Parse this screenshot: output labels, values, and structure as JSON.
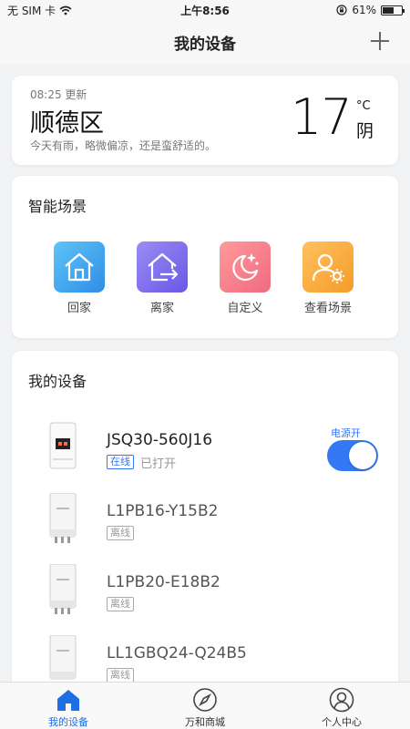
{
  "status_bar": {
    "carrier": "无 SIM 卡",
    "time": "上午8:56",
    "battery": "61%",
    "battery_level": 0.61
  },
  "nav": {
    "title": "我的设备"
  },
  "weather": {
    "updated": "08:25 更新",
    "district": "顺德区",
    "description": "今天有雨，略微偏凉，还是蛮舒适的。",
    "temperature": "17",
    "unit": "°C",
    "condition": "阴"
  },
  "scenes": {
    "title": "智能场景",
    "items": [
      {
        "label": "回家",
        "icon": "home-icon"
      },
      {
        "label": "离家",
        "icon": "leave-home-icon"
      },
      {
        "label": "自定义",
        "icon": "moon-stars-icon"
      },
      {
        "label": "查看场景",
        "icon": "user-settings-icon"
      }
    ]
  },
  "devices": {
    "title": "我的设备",
    "items": [
      {
        "name": "JSQ30-560J16",
        "status": "在线",
        "state": "已打开",
        "power_label": "电源开",
        "power_on": true
      },
      {
        "name": "L1PB16-Y15B2",
        "status": "离线"
      },
      {
        "name": "L1PB20-E18B2",
        "status": "离线"
      },
      {
        "name": "LL1GBQ24-Q24B5",
        "status": "离线"
      }
    ]
  },
  "tabs": {
    "items": [
      {
        "label": "我的设备",
        "icon": "home-icon",
        "active": true
      },
      {
        "label": "万和商城",
        "icon": "compass-icon",
        "active": false
      },
      {
        "label": "个人中心",
        "icon": "user-icon",
        "active": false
      }
    ]
  },
  "colors": {
    "accent": "#3478f6",
    "tab_active": "#1e6ee6"
  }
}
